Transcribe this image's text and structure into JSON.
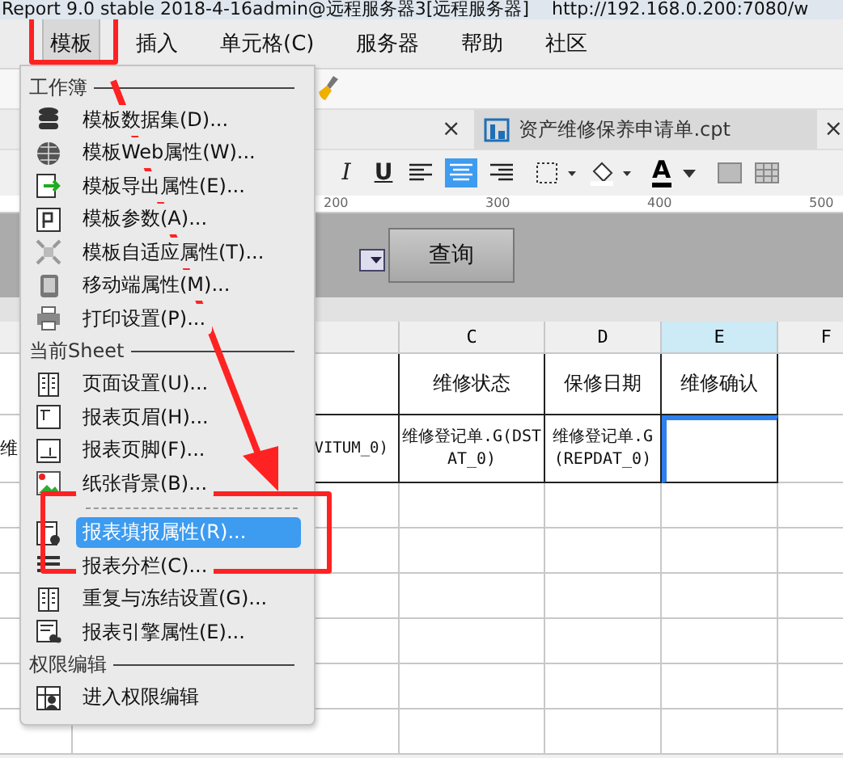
{
  "title_bar": {
    "title": "Report 9.0 stable 2018-4-16admin@远程服务器3[远程服务器]",
    "url": "http://192.168.0.200:7080/w"
  },
  "menu_bar": [
    {
      "label": "模板",
      "selected": true
    },
    {
      "label": "插入",
      "selected": false
    },
    {
      "label": "单元格(C)",
      "selected": false
    },
    {
      "label": "服务器",
      "selected": false
    },
    {
      "label": "帮助",
      "selected": false
    },
    {
      "label": "社区",
      "selected": false
    }
  ],
  "tabs": {
    "close": "×",
    "title": "资产维修保养申请单.cpt",
    "tab_close": "×"
  },
  "format_toolbar": {
    "italic": "I",
    "underline": "U",
    "font_color": "A"
  },
  "ruler": [
    "200",
    "300",
    "400",
    "500"
  ],
  "query_button": "查询",
  "sheet": {
    "columns": [
      {
        "selected": false
      },
      {
        "selected": false
      },
      {
        "label": "C",
        "selected": false
      },
      {
        "label": "D",
        "selected": false
      },
      {
        "label": "E",
        "selected": true
      },
      {
        "label": "F",
        "selected": false
      }
    ],
    "rows": [
      {
        "c": "维修状态",
        "d": "保修日期",
        "e": "维修确认"
      },
      {
        "a": "维",
        "b": "VITUM_0)",
        "c": "维修登记单.G(DSTAT_0)",
        "d": "维修登记单.G(REPDAT_0)"
      }
    ]
  },
  "menu": {
    "sections": [
      {
        "title": "工作簿",
        "items": [
          {
            "kind": "item",
            "label": "模板数据集(D)...",
            "selected": false
          },
          {
            "kind": "item",
            "label": "模板Web属性(W)...",
            "selected": false
          },
          {
            "kind": "item",
            "label": "模板导出属性(E)...",
            "selected": false
          },
          {
            "kind": "item",
            "label": "模板参数(A)...",
            "selected": false
          },
          {
            "kind": "item",
            "label": "模板自适应属性(T)...",
            "selected": false
          },
          {
            "kind": "item",
            "label": "移动端属性(M)...",
            "selected": false
          },
          {
            "kind": "item",
            "label": "打印设置(P)...",
            "selected": false
          }
        ]
      },
      {
        "title": "当前Sheet",
        "items": [
          {
            "kind": "item",
            "label": "页面设置(U)...",
            "selected": false
          },
          {
            "kind": "item",
            "label": "报表页眉(H)...",
            "selected": false
          },
          {
            "kind": "item",
            "label": "报表页脚(F)...",
            "selected": false
          },
          {
            "kind": "item",
            "label": "纸张背景(B)...",
            "selected": false
          },
          {
            "kind": "separator"
          },
          {
            "kind": "item",
            "label": "报表填报属性(R)...",
            "selected": true
          },
          {
            "kind": "item",
            "label": "报表分栏(C)...",
            "selected": false
          },
          {
            "kind": "item",
            "label": "重复与冻结设置(G)...",
            "selected": false
          },
          {
            "kind": "item",
            "label": "报表引擎属性(E)...",
            "selected": false
          }
        ]
      },
      {
        "title": "权限编辑",
        "items": [
          {
            "kind": "item",
            "label": "进入权限编辑",
            "selected": false
          }
        ]
      }
    ]
  }
}
